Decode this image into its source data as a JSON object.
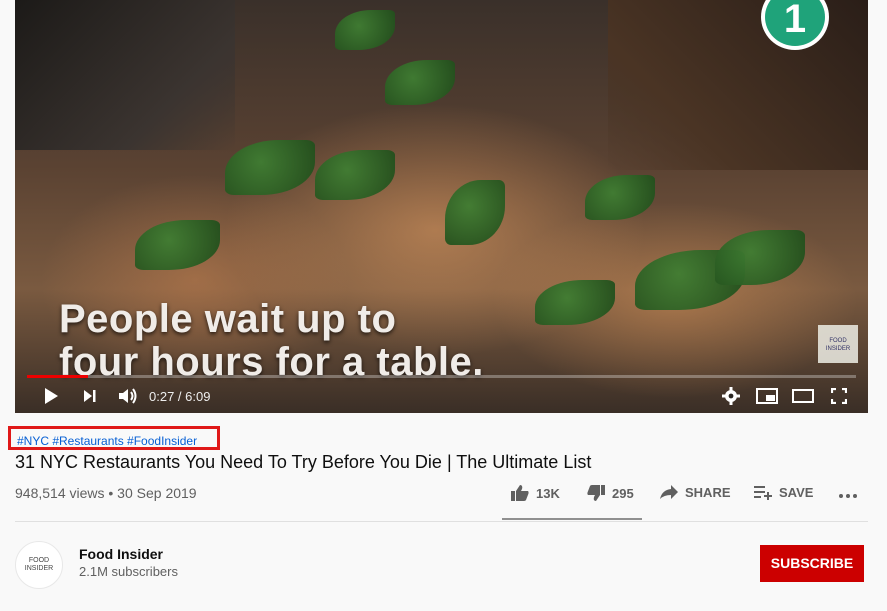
{
  "player": {
    "badge": "1",
    "caption_line1": "People wait up to",
    "caption_line2": "four hours for a table.",
    "watermark": "FOOD INSIDER",
    "time": "0:27 / 6:09",
    "progress": 0.073,
    "icons": [
      "play-icon",
      "next-icon",
      "volume-icon",
      "settings-icon",
      "miniplayer-icon",
      "theater-icon",
      "fullscreen-icon"
    ]
  },
  "video": {
    "hashtags": "#NYC #Restaurants #FoodInsider",
    "title": "31 NYC Restaurants You Need To Try Before You Die | The Ultimate List",
    "meta": "948,514 views • 30 Sep 2019",
    "likes": "13K",
    "dislikes": "295",
    "share_label": "SHARE",
    "save_label": "SAVE"
  },
  "channel": {
    "avatar_text": "FOOD INSIDER",
    "name": "Food Insider",
    "subscribers": "2.1M subscribers",
    "subscribe_label": "SUBSCRIBE"
  },
  "colors": {
    "accent": "#cc0000",
    "hashtag_link": "#065fd4",
    "highlight_box": "#e01818",
    "badge": "#1fa37a"
  }
}
